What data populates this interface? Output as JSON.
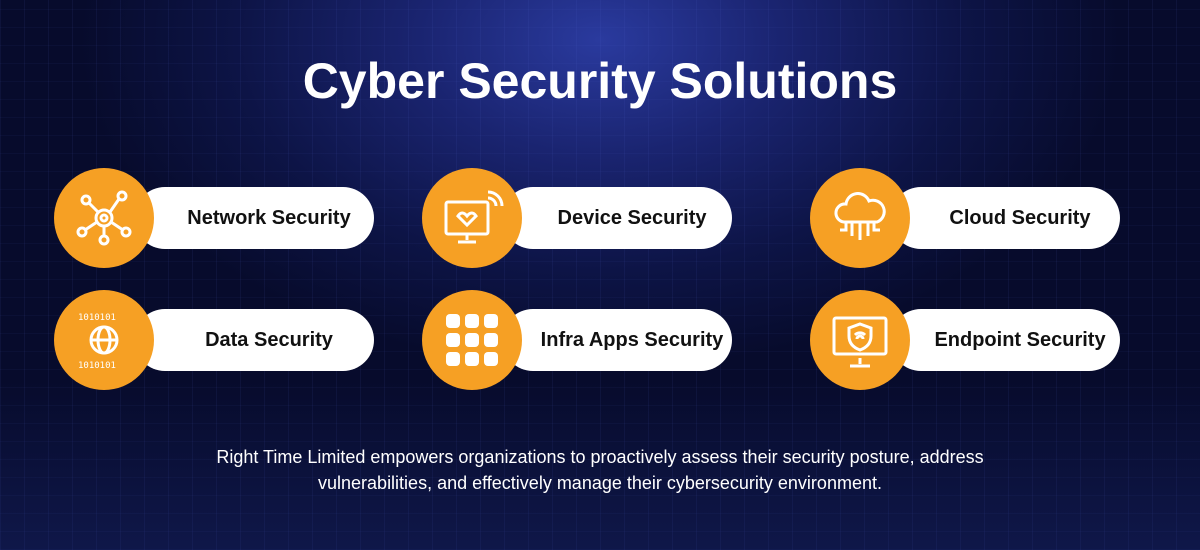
{
  "title": "Cyber Security Solutions",
  "solutions": [
    {
      "label": "Network Security",
      "icon": "network-icon"
    },
    {
      "label": "Device Security",
      "icon": "monitor-heart-wifi-icon"
    },
    {
      "label": "Cloud Security",
      "icon": "cloud-circuit-icon"
    },
    {
      "label": "Data Security",
      "icon": "binary-globe-icon"
    },
    {
      "label": "Infra Apps Security",
      "icon": "app-grid-icon"
    },
    {
      "label": "Endpoint Security",
      "icon": "shield-wifi-monitor-icon"
    }
  ],
  "description_line1": "Right Time Limited empowers organizations to proactively assess their security posture, address",
  "description_line2": "vulnerabilities, and effectively manage their cybersecurity environment.",
  "colors": {
    "accent": "#f6a024",
    "background": "#0d1446"
  }
}
